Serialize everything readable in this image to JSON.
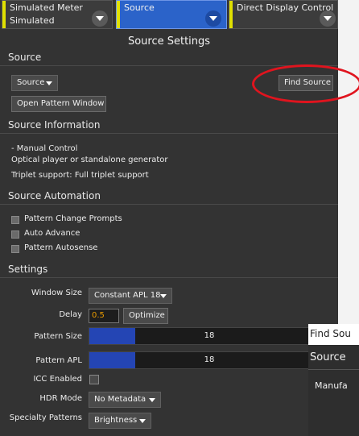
{
  "tabs": [
    {
      "line1": "Simulated Meter",
      "line2": "Simulated",
      "active": false
    },
    {
      "line1": "Source",
      "line2": "",
      "active": true
    },
    {
      "line1": "Direct Display Control",
      "line2": "",
      "active": false
    }
  ],
  "page_title": "Source Settings",
  "source_section": {
    "header": "Source",
    "source_dropdown": "Source",
    "find_source_button": "Find Source",
    "open_pattern_button": "Open Pattern Window"
  },
  "source_info": {
    "header": "Source Information",
    "lines": [
      "- Manual Control",
      "Optical player or standalone generator",
      "Triplet support: Full triplet support"
    ]
  },
  "automation": {
    "header": "Source Automation",
    "options": [
      "Pattern Change Prompts",
      "Auto Advance",
      "Pattern Autosense"
    ]
  },
  "settings": {
    "header": "Settings",
    "window_size_label": "Window Size",
    "window_size_value": "Constant APL 18",
    "delay_label": "Delay",
    "delay_value": "0.5",
    "optimize_button": "Optimize",
    "pattern_size_label": "Pattern Size",
    "pattern_size_value": "18",
    "pattern_size_fraction": 0.19,
    "pattern_apl_label": "Pattern APL",
    "pattern_apl_value": "18",
    "pattern_apl_fraction": 0.19,
    "icc_label": "ICC Enabled",
    "hdr_label": "HDR Mode",
    "hdr_value": "No Metadata",
    "specialty_label": "Specialty Patterns",
    "specialty_value": "Brightness"
  },
  "dialog": {
    "title": "Find Sou",
    "heading": "Source",
    "field": "Manufa"
  },
  "colors": {
    "panel_bg": "#333333",
    "active_tab": "#2b63c9",
    "tab_stripe": "#e0e000",
    "bar_fill": "#2445b4",
    "annotation": "#e0141e",
    "delay_text": "#e89a00"
  }
}
